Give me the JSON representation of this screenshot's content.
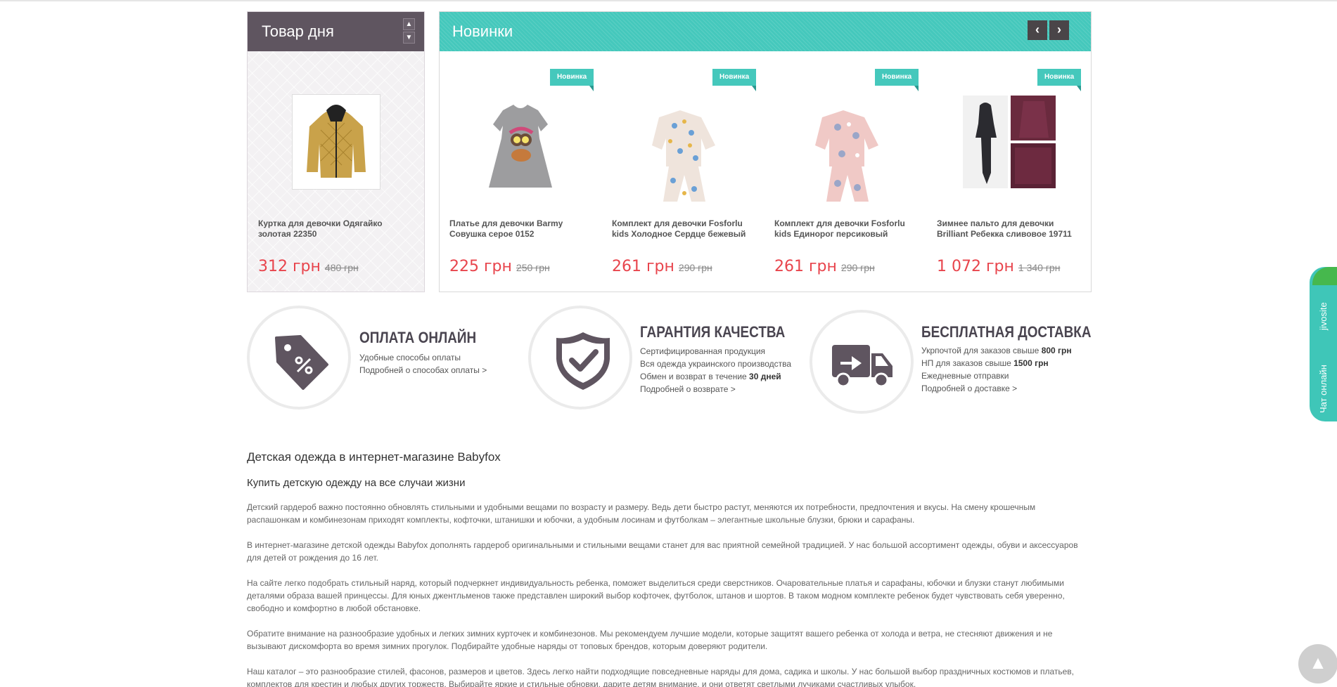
{
  "day": {
    "title": "Товар дня",
    "product": {
      "name": "Куртка для девочки Одягайко золотая 22350",
      "price": "312 грн",
      "old_price": "480 грн"
    }
  },
  "novelties": {
    "title": "Новинки",
    "badge": "Новинка",
    "prev": "‹",
    "next": "›",
    "items": [
      {
        "name": "Платье для девочки Barmy Совушка серое 0152",
        "price": "225 грн",
        "old_price": "250 грн"
      },
      {
        "name": "Комплект для девочки Fosforlu kids Холодное Сердце бежевый",
        "price": "261 грн",
        "old_price": "290 грн"
      },
      {
        "name": "Комплект для девочки Fosforlu kids Единорог персиковый",
        "price": "261 грн",
        "old_price": "290 грн"
      },
      {
        "name": "Зимнее пальто для девочки Brilliant Ребекка сливовое 19711",
        "price": "1 072 грн",
        "old_price": "1 340 грн"
      }
    ]
  },
  "features": {
    "payment": {
      "title": "ОПЛАТА ОНЛАЙН",
      "line1": "Удобные способы оплаты",
      "link": "Подробней о способах оплаты >"
    },
    "quality": {
      "title": "ГАРАНТИЯ КАЧЕСТВА",
      "line1": "Сертифицированная продукция",
      "line2": "Вся одежда украинского производства",
      "line3_pre": "Обмен и возврат в течение ",
      "line3_bold": "30 дней",
      "link": "Подробней о возврате >"
    },
    "delivery": {
      "title": "БЕСПЛАТНАЯ ДОСТАВКА",
      "line1_pre": "Укрпочтой для заказов свыше ",
      "line1_bold": "800 грн",
      "line2_pre": "НП для заказов свыше ",
      "line2_bold": "1500 грн",
      "line3": "Ежедневные отправки",
      "link": "Подробней о доставке >"
    }
  },
  "seo": {
    "h1": "Детская одежда в интернет-магазине Babyfox",
    "h2": "Купить детскую одежду на все случаи жизни",
    "paragraphs": [
      "Детский гардероб важно постоянно обновлять стильными и удобными вещами по возрасту и размеру. Ведь дети быстро растут, меняются их потребности, предпочтения и вкусы. На смену крошечным распашонкам и комбинезонам приходят комплекты, кофточки, штанишки и юбочки, а удобным лосинам и футболкам – элегантные школьные блузки, брюки и сарафаны.",
      "В интернет-магазине детской одежды Babyfox дополнять гардероб оригинальными и стильными вещами станет для вас приятной семейной традицией. У нас большой ассортимент одежды, обуви и аксессуаров для детей от рождения до 16 лет.",
      "На сайте легко подобрать стильный наряд, который подчеркнет индивидуальность ребенка, поможет выделиться среди сверстников. Очаровательные платья и сарафаны, юбочки и блузки станут любимыми деталями образа вашей принцессы. Для юных джентльменов также представлен широкий выбор кофточек, футболок, штанов и шортов. В таком модном комплекте ребенок будет чувствовать себя уверенно, свободно и комфортно в любой обстановке.",
      "Обратите внимание на разнообразие удобных и легких зимних курточек и комбинезонов. Мы рекомендуем лучшие модели, которые защитят вашего ребенка от холода и ветра, не стесняют движения и не вызывают дискомфорта во время зимних прогулок. Подбирайте удобные наряды от топовых брендов, которым доверяют родители.",
      "Наш каталог – это разнообразие стилей, фасонов, размеров и цветов. Здесь легко найти подходящие повседневные наряды для дома, садика и школы. У нас большой выбор праздничных костюмов и платьев, комплектов для крестин и любых других торжеств. Выбирайте яркие и стильные обновки, дарите детям внимание, и они ответят светлыми лучиками счастливых улыбок."
    ]
  },
  "chat": {
    "brand": "jivosite",
    "label": "Чат онлайн"
  },
  "colors": {
    "accent": "#45c8bc",
    "dark": "#5f5560",
    "price": "#e8444c"
  },
  "icons": {
    "up": "chevron-up-icon",
    "down": "chevron-down-icon",
    "payment": "price-tag-percent-icon",
    "quality": "shield-check-icon",
    "delivery": "truck-icon",
    "totop": "scroll-to-top-icon"
  }
}
